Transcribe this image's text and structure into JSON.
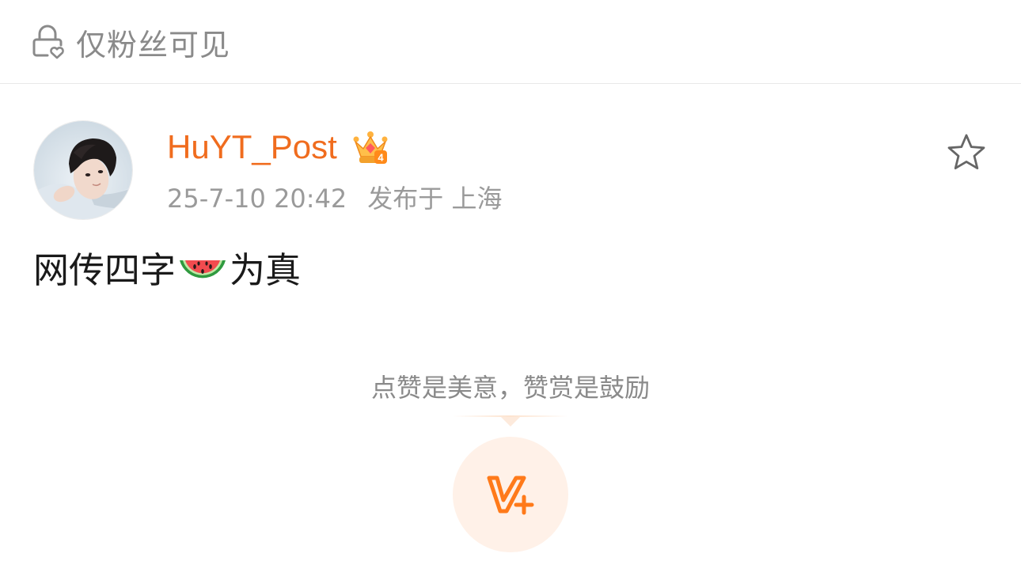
{
  "visibility": {
    "label": "仅粉丝可见",
    "icon": "lock-heart-icon"
  },
  "post": {
    "author": {
      "name": "HuYT_Post",
      "badge_icon": "crown-vip-icon",
      "badge_level": "4"
    },
    "time": "25-7-10 20:42",
    "location": "发布于 上海",
    "favorite_icon": "star-outline-icon",
    "content": {
      "before": "网传四字",
      "emoji": "watermelon-icon",
      "after": "为真"
    }
  },
  "reward": {
    "tip": "点赞是美意，赞赏是鼓励",
    "icon": "v-plus-icon"
  },
  "colors": {
    "username": "#f06c1e",
    "accent": "#ff7a1a",
    "reward_bg": "#fff1e8",
    "muted_text": "#8a8a8a",
    "primary_text": "#1a1a1a"
  }
}
